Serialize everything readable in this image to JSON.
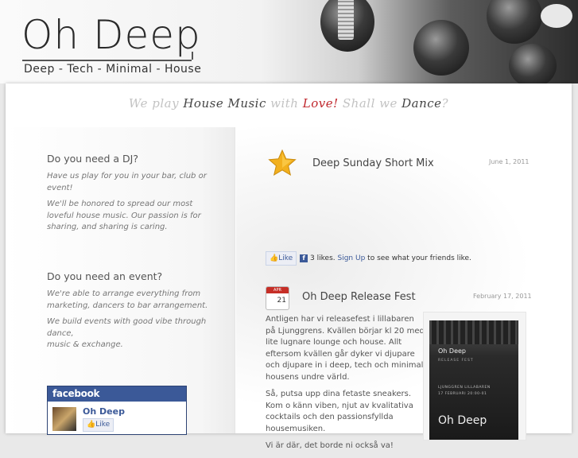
{
  "header": {
    "logo": "Oh Deep",
    "tagline": "Deep - Tech - Minimal - House"
  },
  "motto": {
    "part1": "We play ",
    "part2": "House Music",
    "part3": " with ",
    "part4": "Love!",
    "part5": " Shall we ",
    "part6": "Dance",
    "part7": "?"
  },
  "sidebar": {
    "dj_heading": "Do you need a DJ?",
    "dj_p1": "Have us play for you in your bar, club or event!",
    "dj_p2": "We'll be honored to spread our most loveful house music. Our passion is for sharing, and sharing is caring.",
    "event_heading": "Do you need an event?",
    "event_p1": "We're able to arrange everything from marketing, dancers to bar arrangement.",
    "event_p2a": "We build events with good vibe through dance,",
    "event_p2b": "music & exchange.",
    "facebook": {
      "brand": "facebook",
      "page_name": "Oh Deep",
      "like_label": "Like"
    }
  },
  "posts": [
    {
      "title": "Deep Sunday Short Mix",
      "date": "June 1, 2011",
      "icon": "star-icon",
      "like_label": "Like",
      "likes_text": "3 likes.",
      "signup_label": "Sign Up",
      "friends_text": "to see what your friends like."
    },
    {
      "title": "Oh Deep Release Fest",
      "date": "February 17, 2011",
      "icon": "calendar-icon",
      "calendar_month": "APR",
      "calendar_day": "21",
      "body_p1": "Antligen har vi releasefest i lillabaren på Ljunggrens. Kvällen börjar kl 20 med lite lugnare lounge och house. Allt eftersom kvällen går dyker vi djupare och djupare in i deep, tech och minimal housens undre värld.",
      "body_p2": "Så, putsa upp dina fetaste sneakers. Kom o känn viben, njut av kvalitativa cocktails och den passionsfyllda housemusiken.",
      "body_p3": "Vi är där, det borde ni också va!",
      "poster": {
        "title": "Oh Deep",
        "subtitle": "RELEASE FEST",
        "venue": "LJUNGGREN LILLABAREN",
        "datetime": "17 FEBRUARI 20:00-01",
        "brand": "Oh Deep"
      }
    }
  ],
  "colors": {
    "facebook_blue": "#3b5998",
    "love_red": "#c0272d",
    "star_gold": "#f2b01e"
  }
}
